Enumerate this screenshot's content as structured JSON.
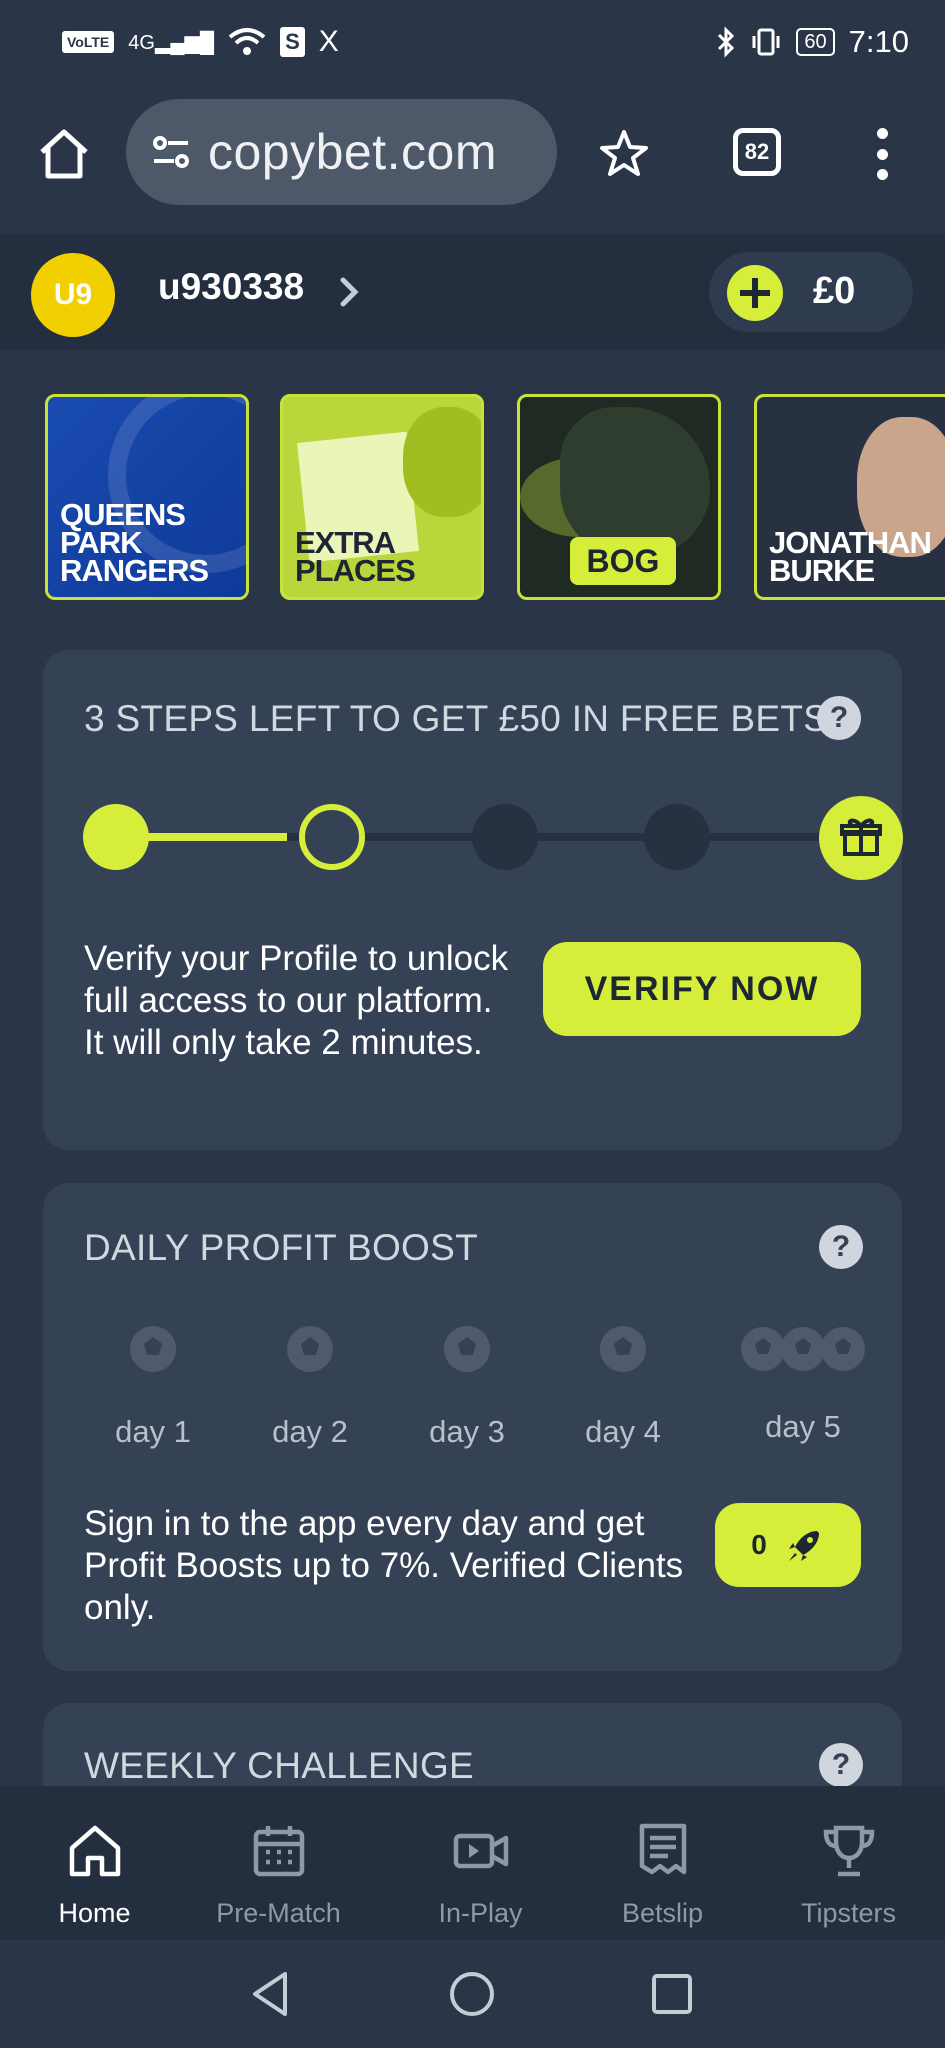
{
  "status_bar": {
    "network": "VoLTE",
    "signal": "4G",
    "app_badge": "S",
    "app_badge_2": "X",
    "battery": "60",
    "time": "7:10"
  },
  "browser": {
    "url": "copybet.com",
    "tab_count": "82"
  },
  "account": {
    "avatar_initials": "U9",
    "username": "u930338",
    "balance": "£0",
    "accent_color": "#d6ee3a"
  },
  "promo_tiles": [
    {
      "label": "QUEENS\nPARK\nRANGERS"
    },
    {
      "label": "EXTRA\nPLACES"
    },
    {
      "label": "BOG"
    },
    {
      "label": "JONATHAN\nBURKE"
    }
  ],
  "steps_card": {
    "title": "3 STEPS LEFT TO GET £50 IN FREE BETS",
    "completed_steps": 1,
    "current_step": 2,
    "total_steps": 4,
    "description": "Verify your Profile to unlock full access to our platform. It will only take 2 minutes.",
    "button_label": "VERIFY NOW"
  },
  "boost_card": {
    "title": "DAILY PROFIT BOOST",
    "days": [
      "day 1",
      "day 2",
      "day 3",
      "day 4",
      "day 5"
    ],
    "description": "Sign in to the app every day and get Profit Boosts up to 7%. Verified Clients only.",
    "boost_count": "0"
  },
  "weekly_card": {
    "title": "WEEKLY CHALLENGE"
  },
  "bottom_nav": [
    {
      "label": "Home",
      "icon": "home-icon",
      "active": true
    },
    {
      "label": "Pre-Match",
      "icon": "calendar-icon",
      "active": false
    },
    {
      "label": "In-Play",
      "icon": "video-icon",
      "active": false
    },
    {
      "label": "Betslip",
      "icon": "betslip-icon",
      "active": false
    },
    {
      "label": "Tipsters",
      "icon": "trophy-icon",
      "active": false
    }
  ]
}
